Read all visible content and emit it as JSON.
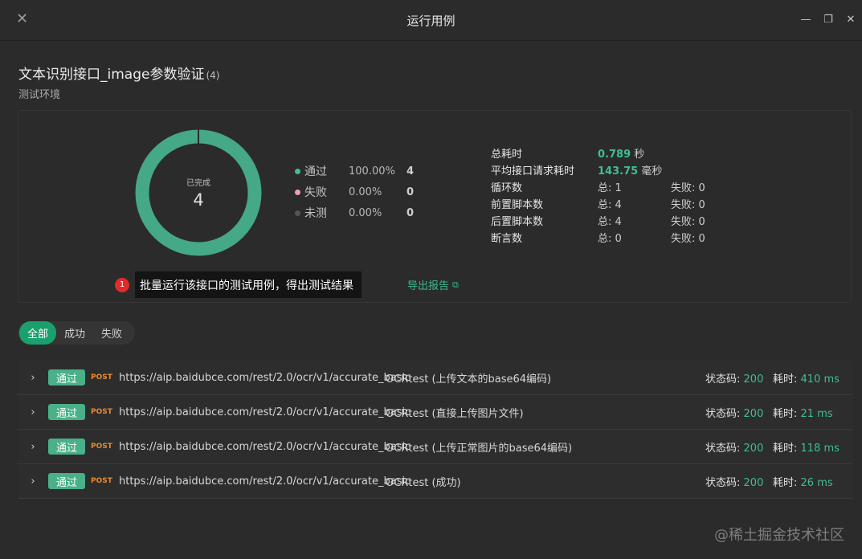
{
  "window": {
    "title": "运行用例",
    "close_icon": "close-icon",
    "restore_icon": "restore-icon"
  },
  "header": {
    "case_name": "文本识别接口_image参数验证",
    "case_count": "(4)",
    "environment": "测试环境"
  },
  "donut": {
    "center_label": "已完成",
    "center_value": "4",
    "pass_fraction": 1.0,
    "pass_color": "#45a886",
    "fail_color": "#e68aa6",
    "untested_color": "#555555"
  },
  "legend": [
    {
      "name": "通过",
      "pct": "100.00%",
      "count": "4",
      "color": "#3fbf8f"
    },
    {
      "name": "失败",
      "pct": "0.00%",
      "count": "0",
      "color": "#ef9fb7"
    },
    {
      "name": "未测",
      "pct": "0.00%",
      "count": "0",
      "color": "#555555"
    }
  ],
  "stats": {
    "total_time": {
      "label": "总耗时",
      "value": "0.789",
      "unit": "秒"
    },
    "avg_time": {
      "label": "平均接口请求耗时",
      "value": "143.75",
      "unit": "毫秒"
    },
    "loops": {
      "label": "循环数",
      "total": "总: 1",
      "fail": "失败: 0"
    },
    "pre_scripts": {
      "label": "前置脚本数",
      "total": "总: 4",
      "fail": "失败: 0"
    },
    "post_scripts": {
      "label": "后置脚本数",
      "total": "总: 4",
      "fail": "失败: 0"
    },
    "assertions": {
      "label": "断言数",
      "total": "总: 0",
      "fail": "失败: 0"
    }
  },
  "tip": {
    "badge": "1",
    "text": "批量运行该接口的测试用例，得出测试结果"
  },
  "export_label": "导出报告",
  "filters": [
    "全部",
    "成功",
    "失败"
  ],
  "results": [
    {
      "status": "通过",
      "method": "POST",
      "url": "https://aip.baidubce.com/rest/2.0/ocr/v1/accurate_basic",
      "case": "OCRtest (上传文本的base64编码)",
      "code_label": "状态码:",
      "code": "200",
      "time_label": "耗时:",
      "time": "410 ms"
    },
    {
      "status": "通过",
      "method": "POST",
      "url": "https://aip.baidubce.com/rest/2.0/ocr/v1/accurate_basic",
      "case": "OCRtest (直接上传图片文件)",
      "code_label": "状态码:",
      "code": "200",
      "time_label": "耗时:",
      "time": "21 ms"
    },
    {
      "status": "通过",
      "method": "POST",
      "url": "https://aip.baidubce.com/rest/2.0/ocr/v1/accurate_basic",
      "case": "OCRtest (上传正常图片的base64编码)",
      "code_label": "状态码:",
      "code": "200",
      "time_label": "耗时:",
      "time": "118 ms"
    },
    {
      "status": "通过",
      "method": "POST",
      "url": "https://aip.baidubce.com/rest/2.0/ocr/v1/accurate_basic",
      "case": "OCRtest (成功)",
      "code_label": "状态码:",
      "code": "200",
      "time_label": "耗时:",
      "time": "26 ms"
    }
  ],
  "watermark": "@稀土掘金技术社区"
}
